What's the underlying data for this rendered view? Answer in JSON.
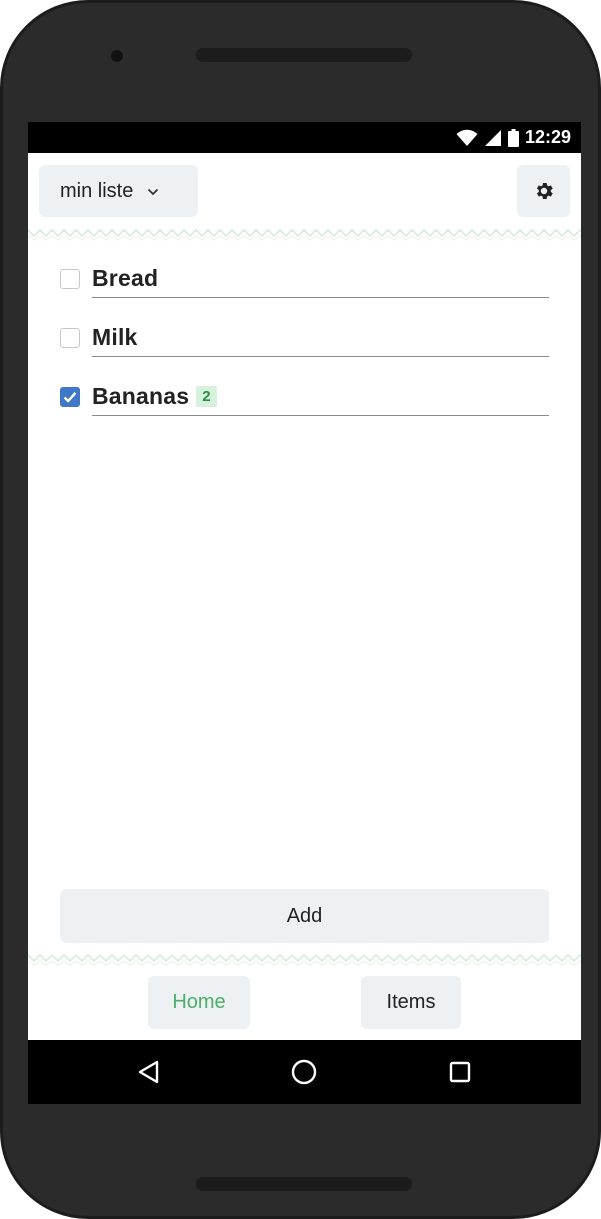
{
  "status_bar": {
    "time": "12:29",
    "icons": [
      "wifi-icon",
      "signal-icon",
      "battery-icon"
    ]
  },
  "app_bar": {
    "list_name": "min liste",
    "settings_icon": "gear-icon"
  },
  "items": [
    {
      "name": "Bread",
      "checked": false,
      "quantity": null
    },
    {
      "name": "Milk",
      "checked": false,
      "quantity": null
    },
    {
      "name": "Bananas",
      "checked": true,
      "quantity": "2"
    }
  ],
  "add_button": {
    "label": "Add"
  },
  "tabs": [
    {
      "label": "Home",
      "active": true
    },
    {
      "label": "Items",
      "active": false
    }
  ],
  "nav_bar": {
    "icons": [
      "back-icon",
      "home-icon",
      "recents-icon"
    ]
  },
  "colors": {
    "accent_green": "#4caf6a",
    "checkbox_blue": "#3e78c7",
    "button_bg": "#eef1f4",
    "badge_bg": "#d6f2dc"
  }
}
